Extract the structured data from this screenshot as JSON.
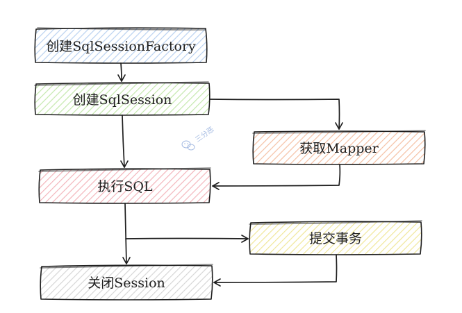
{
  "diagram": {
    "nodes": [
      {
        "id": "create-factory",
        "label": "创建SqlSessionFactory",
        "fill": "#dbe8f8"
      },
      {
        "id": "create-session",
        "label": "创建SqlSession",
        "fill": "#d5efc4"
      },
      {
        "id": "get-mapper",
        "label": "获取Mapper",
        "fill": "#f8d4c0"
      },
      {
        "id": "execute-sql",
        "label": "执行SQL",
        "fill": "#f8c8cc"
      },
      {
        "id": "commit-tx",
        "label": "提交事务",
        "fill": "#f7f2b8"
      },
      {
        "id": "close-session",
        "label": "关闭Session",
        "fill": "#e4e4e4"
      }
    ],
    "edges": [
      {
        "from": "create-factory",
        "to": "create-session"
      },
      {
        "from": "create-session",
        "to": "execute-sql"
      },
      {
        "from": "create-session",
        "to": "get-mapper"
      },
      {
        "from": "get-mapper",
        "to": "execute-sql"
      },
      {
        "from": "execute-sql",
        "to": "close-session"
      },
      {
        "from": "execute-sql",
        "to": "commit-tx"
      },
      {
        "from": "commit-tx",
        "to": "close-session"
      }
    ]
  },
  "watermark": {
    "text": "三分恶",
    "icon": "wechat-icon",
    "color": "#9ab3df"
  }
}
